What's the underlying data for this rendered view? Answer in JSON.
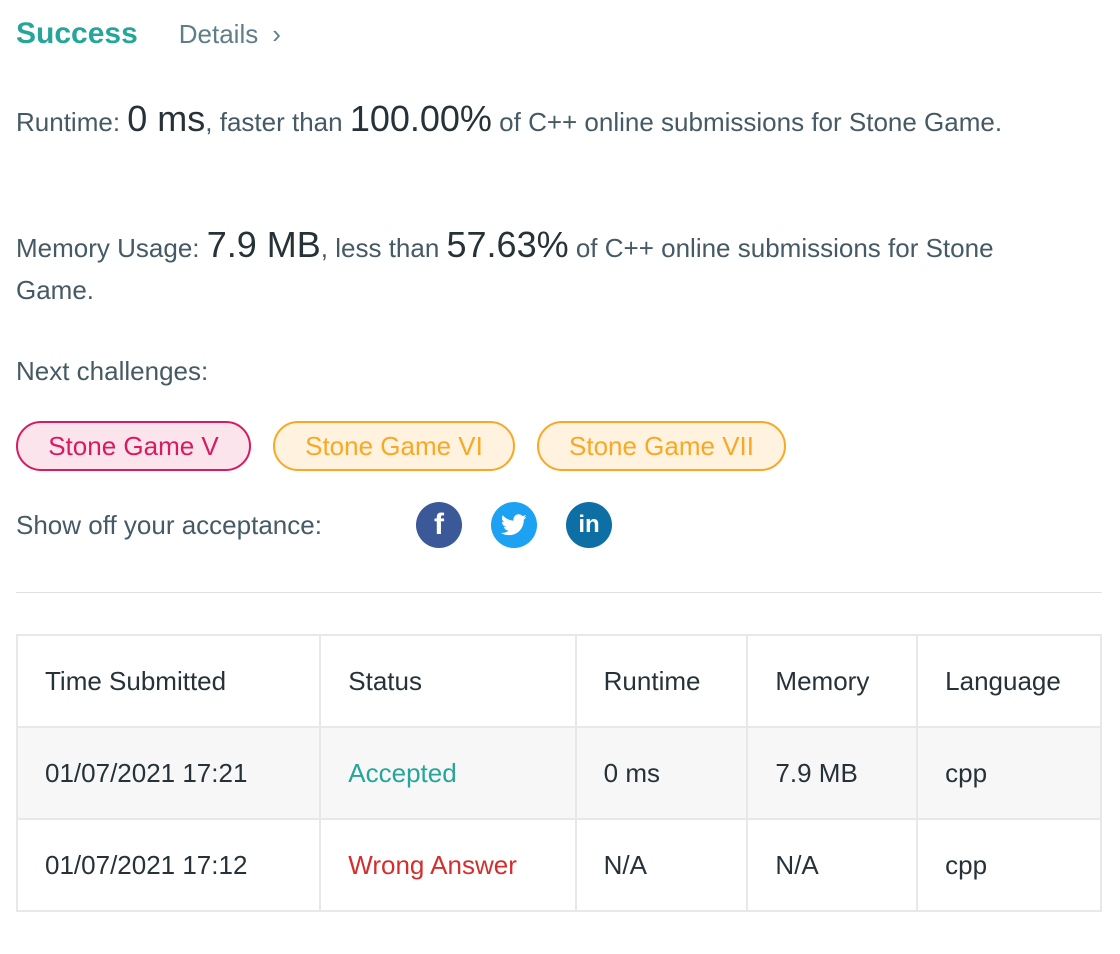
{
  "header": {
    "status": "Success",
    "details_label": "Details",
    "chevron": "›"
  },
  "runtime": {
    "prefix": "Runtime: ",
    "value": "0 ms",
    "mid": ", faster than ",
    "percent": "100.00%",
    "suffix": " of C++ online submissions for Stone Game."
  },
  "memory": {
    "prefix": "Memory Usage: ",
    "value": "7.9 MB",
    "mid": ", less than ",
    "percent": "57.63%",
    "suffix": " of C++ online submissions for Stone Game."
  },
  "next": {
    "label": "Next challenges:",
    "items": [
      {
        "label": "Stone Game V",
        "difficulty": "hard"
      },
      {
        "label": "Stone Game VI",
        "difficulty": "medium"
      },
      {
        "label": "Stone Game VII",
        "difficulty": "medium"
      }
    ]
  },
  "share": {
    "label": "Show off your acceptance:",
    "icons": [
      "facebook-icon",
      "twitter-icon",
      "linkedin-icon"
    ],
    "fb_glyph": "f",
    "li_glyph": "in"
  },
  "table": {
    "headers": [
      "Time Submitted",
      "Status",
      "Runtime",
      "Memory",
      "Language"
    ],
    "rows": [
      [
        "01/07/2021 17:21",
        "Accepted",
        "0 ms",
        "7.9 MB",
        "cpp"
      ],
      [
        "01/07/2021 17:12",
        "Wrong Answer",
        "N/A",
        "N/A",
        "cpp"
      ]
    ]
  },
  "colors": {
    "success": "#26a69a",
    "wrong": "#d32f2f",
    "hard": "#d81b60",
    "medium": "#f9a825",
    "facebook": "#3b5998",
    "twitter": "#1da1f2",
    "linkedin": "#0e6fa5"
  }
}
